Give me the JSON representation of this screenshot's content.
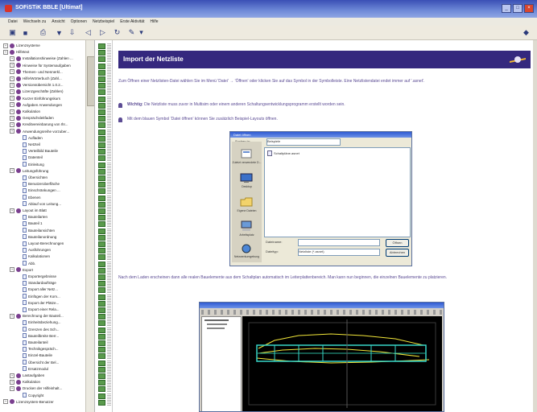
{
  "window": {
    "title": "SOFiSTiK BBLE [Ultimat]",
    "controls": [
      "_",
      "□",
      "×"
    ]
  },
  "menu": [
    "Datei",
    "Wechseln zu",
    "Ansicht",
    "Optionen",
    "Netzbeispiel",
    "Erste Aktivität",
    "Hilfe"
  ],
  "toolbar_icons": [
    "back-icon",
    "save-icon",
    "print-icon",
    "filter-icon",
    "down-icon",
    "arrow-left-icon",
    "arrow-right-icon",
    "refresh-icon",
    "pencil-icon",
    "dropdown-icon",
    "pin-icon"
  ],
  "sidebar": {
    "items": [
      {
        "label": "Lizenzsysteme",
        "level": 0,
        "kind": "dot"
      },
      {
        "label": "Hilfetext",
        "level": 0,
        "kind": "dot"
      },
      {
        "label": "Installationshinweise (Zahlen ...",
        "level": 1,
        "kind": "dot"
      },
      {
        "label": "Hinweise für Systemaufgaben",
        "level": 1,
        "kind": "dot"
      },
      {
        "label": "Themen- und Nennerkl...",
        "level": 1,
        "kind": "dot"
      },
      {
        "label": "Hilfe/Wörterbuch (Zahl...",
        "level": 1,
        "kind": "dot"
      },
      {
        "label": "Versionsübersicht 1.0.2...",
        "level": 1,
        "kind": "dot"
      },
      {
        "label": "Lizenzgeschäfte (Zahlen)",
        "level": 1,
        "kind": "dot"
      },
      {
        "label": "Kurzer Einführungskurs",
        "level": 1,
        "kind": "dot"
      },
      {
        "label": "Aufgaben Anwendungen",
        "level": 1,
        "kind": "dot"
      },
      {
        "label": "Kalkulation",
        "level": 1,
        "kind": "dot"
      },
      {
        "label": "Gesprächsleitfaden",
        "level": 1,
        "kind": "dot"
      },
      {
        "label": "Kreditvereinbarung von Ihr...",
        "level": 1,
        "kind": "dot"
      },
      {
        "label": "Anwendungsreihe vorzuber...",
        "level": 1,
        "kind": "dot"
      },
      {
        "label": "Aufladen",
        "level": 2,
        "kind": "page"
      },
      {
        "label": "Netzteil",
        "level": 2,
        "kind": "page"
      },
      {
        "label": "Verteilbild Bauteile",
        "level": 2,
        "kind": "page"
      },
      {
        "label": "Datenteil",
        "level": 2,
        "kind": "page"
      },
      {
        "label": "Einleitung",
        "level": 2,
        "kind": "page"
      },
      {
        "label": "Leitungsführung",
        "level": 1,
        "kind": "dot"
      },
      {
        "label": "Übersichten",
        "level": 2,
        "kind": "page"
      },
      {
        "label": "Benutzeroberfläche",
        "level": 2,
        "kind": "page"
      },
      {
        "label": "Einschränkungen ...",
        "level": 2,
        "kind": "page"
      },
      {
        "label": "Ebenen",
        "level": 2,
        "kind": "page"
      },
      {
        "label": "Ablauf von Leitung...",
        "level": 2,
        "kind": "page"
      },
      {
        "label": "Layout im Blatt",
        "level": 1,
        "kind": "dot"
      },
      {
        "label": "Bauteilarten",
        "level": 2,
        "kind": "page"
      },
      {
        "label": "Bauteil 1",
        "level": 2,
        "kind": "page"
      },
      {
        "label": "Bauteilansichten",
        "level": 2,
        "kind": "page"
      },
      {
        "label": "Bauteilanordnung",
        "level": 2,
        "kind": "page"
      },
      {
        "label": "Layout-Berechnungen",
        "level": 2,
        "kind": "page"
      },
      {
        "label": "Ausführungen",
        "level": 2,
        "kind": "page"
      },
      {
        "label": "Kalkulationen",
        "level": 2,
        "kind": "page"
      },
      {
        "label": "Abb.",
        "level": 2,
        "kind": "page"
      },
      {
        "label": "Export",
        "level": 1,
        "kind": "dot"
      },
      {
        "label": "Exportergebnisse",
        "level": 2,
        "kind": "page"
      },
      {
        "label": "Standardaufträge",
        "level": 2,
        "kind": "page"
      },
      {
        "label": "Export aller Netz...",
        "level": 2,
        "kind": "page"
      },
      {
        "label": "Einfügen der Kom...",
        "level": 2,
        "kind": "page"
      },
      {
        "label": "Export der Plätze...",
        "level": 2,
        "kind": "page"
      },
      {
        "label": "Export einer Rela...",
        "level": 2,
        "kind": "page"
      },
      {
        "label": "Berechnung der Bauteil...",
        "level": 1,
        "kind": "dot"
      },
      {
        "label": "Einheitsbeziehung...",
        "level": 2,
        "kind": "page"
      },
      {
        "label": "Grenzen des Sch...",
        "level": 2,
        "kind": "page"
      },
      {
        "label": "Bauteilbreite Berr...",
        "level": 2,
        "kind": "page"
      },
      {
        "label": "Bauteilanteil",
        "level": 2,
        "kind": "page"
      },
      {
        "label": "Technikgespräch...",
        "level": 2,
        "kind": "page"
      },
      {
        "label": "Einzel-Bauteile",
        "level": 2,
        "kind": "page"
      },
      {
        "label": "Übersicht der Bel...",
        "level": 2,
        "kind": "page"
      },
      {
        "label": "Ersatzmodul",
        "level": 2,
        "kind": "page"
      },
      {
        "label": "Lastaufgaben",
        "level": 1,
        "kind": "dot"
      },
      {
        "label": "Kalkulation",
        "level": 1,
        "kind": "dot"
      },
      {
        "label": "Drucken der Hilfeinhalt...",
        "level": 1,
        "kind": "dot"
      },
      {
        "label": "Copyright",
        "level": 2,
        "kind": "page"
      },
      {
        "label": "Lizenzsystem-Benutzer",
        "level": 0,
        "kind": "dot"
      }
    ]
  },
  "content": {
    "heading": "Import der Netzliste",
    "intro": "Zum Öffnen einer Netzlisten-Datei wählen Sie im Menü 'Datei' → 'Öffnen' oder klicken Sie auf das Symbol in der Symbolleiste. Eine Netzlistendatei endet immer auf '.asnet'.",
    "note_label": "Wichtig:",
    "note_text": "Die Netzliste muss zuvor in Multisim oder einem anderen Schaltungsentwicklungsprogramm erstellt worden sein.",
    "hint": "Mit dem blauen Symbol 'Datei öffnen' können Sie zusätzlich Beispiel-Layouts öffnen.",
    "after_load": "Nach dem Laden erscheinen dann alle realen Bauelemente aus dem Schaltplan automatisch im Leiterplattenbereich. Man kann nun beginnen, die einzelnen Bauelemente zu platzieren."
  },
  "dialog": {
    "title": "Datei öffnen",
    "lookin_label": "Suchen in:",
    "lookin_value": "Beispiele",
    "file_entry": "Schaltpläne.asnet",
    "nav": [
      "Zuletzt verwendete D...",
      "Desktop",
      "Eigene Dateien",
      "Arbeitsplatz",
      "Netzwerkumgebung"
    ],
    "filename_label": "Dateiname:",
    "filetype_label": "Dateityp:",
    "filetype_value": "Netzliste (*.asnet)",
    "open_button": "Öffnen",
    "cancel_button": "Abbrechen"
  },
  "colors": {
    "heading_bg": "#35287e",
    "body_text": "#5a4a93",
    "tree_dot": "#7a3f8f",
    "titlebar": "#3a4fb5"
  }
}
